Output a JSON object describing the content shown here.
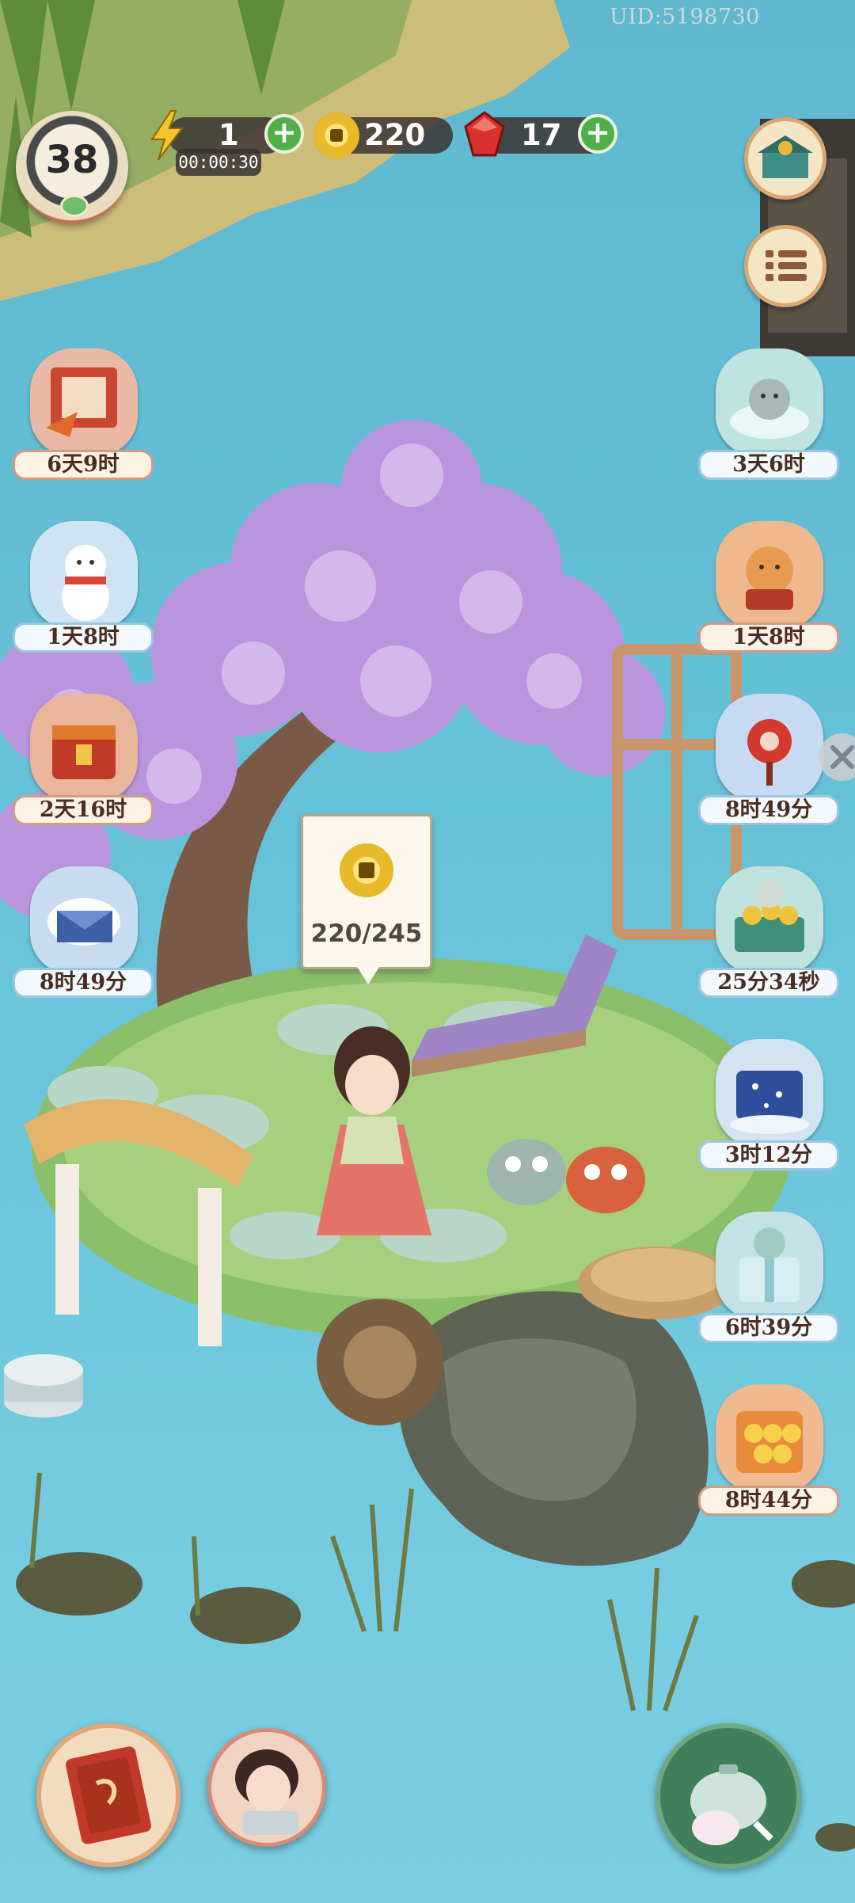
{
  "hud": {
    "uid": "UID:5198730",
    "level": "38",
    "energy": {
      "value": "1",
      "timer": "00:00:30"
    },
    "coins": {
      "value": "220"
    },
    "gems": {
      "value": "17"
    },
    "plus_label": "+"
  },
  "events_left": [
    {
      "icon": "maple-leaf-scroll-icon",
      "timer": "6天9时"
    },
    {
      "icon": "snowman-cat-icon",
      "timer": "1天8时"
    },
    {
      "icon": "treasure-chest-icon",
      "timer": "2天16时"
    },
    {
      "icon": "envelope-cat-icon",
      "timer": "8时49分"
    }
  ],
  "events_right": [
    {
      "icon": "hot-spring-cat-icon",
      "timer": "3天6时"
    },
    {
      "icon": "lucky-cat-icon",
      "timer": "1天8时"
    },
    {
      "icon": "red-ornament-icon",
      "timer": "8时49分"
    },
    {
      "icon": "coin-cart-cat-icon",
      "timer": "25分34秒"
    },
    {
      "icon": "starry-chest-icon",
      "timer": "3时12分"
    },
    {
      "icon": "gift-box-cat-icon",
      "timer": "6时39分"
    },
    {
      "icon": "coin-pouch-icon",
      "timer": "8时44分"
    }
  ],
  "coin_bubble": {
    "count": "220/245"
  },
  "colors": {
    "water": "#64c0d6",
    "blossom": "#b995dd",
    "plus_button": "#4fb04a",
    "label_border_warm": "#d39a86",
    "label_border_cool": "#9cc7e2"
  }
}
